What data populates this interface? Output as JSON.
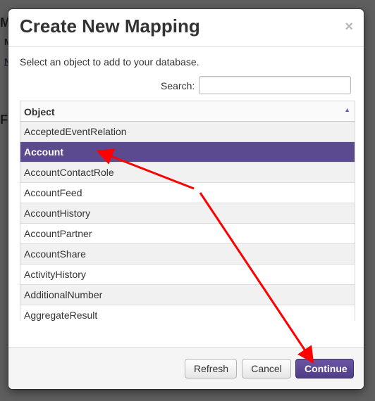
{
  "background": {
    "letters": [
      "M",
      "M",
      "N",
      "Fi"
    ]
  },
  "modal": {
    "title": "Create New Mapping",
    "close_glyph": "×",
    "instruction": "Select an object to add to your database.",
    "search": {
      "label": "Search:",
      "value": "",
      "placeholder": ""
    },
    "table": {
      "column_header": "Object",
      "sort_glyph": "▲",
      "rows": [
        "AcceptedEventRelation",
        "Account",
        "AccountContactRole",
        "AccountFeed",
        "AccountHistory",
        "AccountPartner",
        "AccountShare",
        "ActivityHistory",
        "AdditionalNumber",
        "AggregateResult"
      ],
      "selected": "Account"
    },
    "buttons": {
      "refresh": "Refresh",
      "cancel": "Cancel",
      "continue": "Continue"
    }
  },
  "colors": {
    "accent": "#5c4a8e",
    "annotation_arrow": "#ff0000"
  }
}
